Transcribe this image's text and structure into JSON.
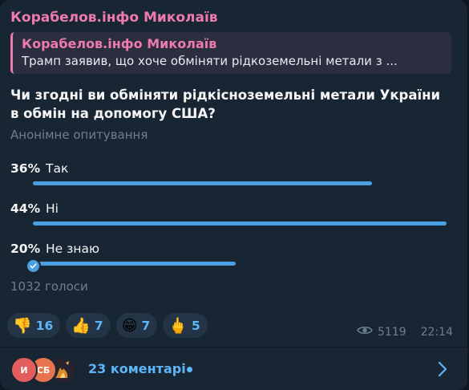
{
  "channel": {
    "name": "Корабелов.інфо Миколаїв"
  },
  "reply": {
    "author": "Корабелов.інфо Миколаїв",
    "text": "Трамп заявив, що хоче обміняти рідкоземельні метали з ..."
  },
  "poll": {
    "question": "Чи згодні ви обміняти рідкісноземельні метали України в обмін на допомогу США?",
    "type": "Анонімне опитування",
    "options": [
      {
        "percent_label": "36%",
        "label": "Так",
        "percent": 36,
        "bar_fill": 0.82
      },
      {
        "percent_label": "44%",
        "label": "Ні",
        "percent": 44,
        "bar_fill": 1.0
      },
      {
        "percent_label": "20%",
        "label": "Не знаю",
        "percent": 20,
        "bar_fill": 0.49,
        "voted": true
      }
    ],
    "total_votes": "1032 голоси"
  },
  "reactions": [
    {
      "emoji": "👎",
      "icon": "thumbs-down-icon",
      "count": "16"
    },
    {
      "emoji": "👍",
      "icon": "thumbs-up-icon",
      "count": "7"
    },
    {
      "emoji": "😁",
      "icon": "grin-icon",
      "count": "7"
    },
    {
      "emoji": "🖕",
      "icon": "middle-finger-icon",
      "count": "5"
    }
  ],
  "meta": {
    "views": "5119",
    "time": "22:14"
  },
  "comments": {
    "label": "23 коментарі",
    "avatars": [
      {
        "initials": "И",
        "color": "#e35d5d"
      },
      {
        "initials": "СБ",
        "color": "#e8744f"
      },
      {
        "initials": "",
        "color": "#2b2230"
      }
    ]
  },
  "colors": {
    "accent": "#ee7aae",
    "bar": "#4aa0e0",
    "link": "#5eb5f7",
    "background": "#182533"
  }
}
